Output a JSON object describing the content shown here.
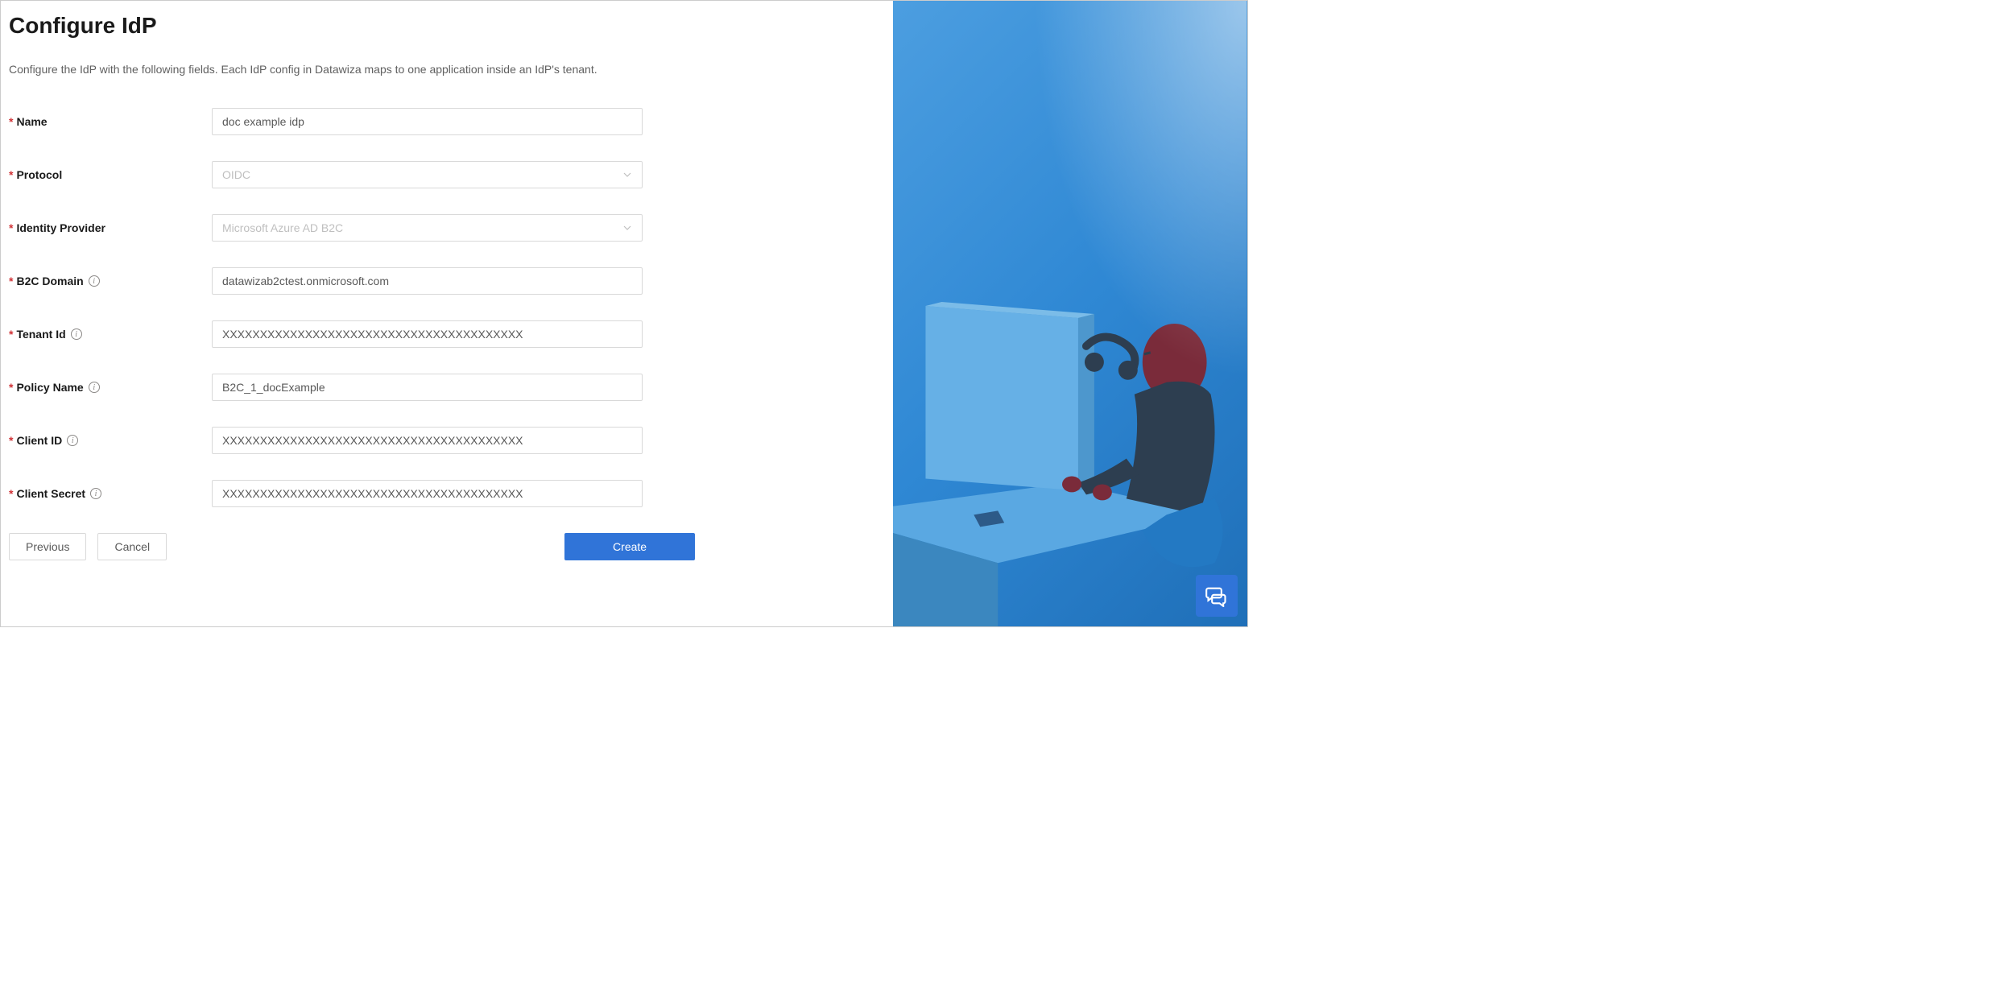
{
  "header": {
    "title": "Configure IdP",
    "description": "Configure the IdP with the following fields. Each IdP config in Datawiza maps to one application inside an IdP's tenant."
  },
  "form": {
    "fields": [
      {
        "label": "Name",
        "required": true,
        "info": false,
        "type": "text",
        "value": "doc example idp"
      },
      {
        "label": "Protocol",
        "required": true,
        "info": false,
        "type": "select",
        "value": "OIDC"
      },
      {
        "label": "Identity Provider",
        "required": true,
        "info": false,
        "type": "select",
        "value": "Microsoft Azure AD B2C"
      },
      {
        "label": "B2C Domain",
        "required": true,
        "info": true,
        "type": "text",
        "value": "datawizab2ctest.onmicrosoft.com"
      },
      {
        "label": "Tenant Id",
        "required": true,
        "info": true,
        "type": "text",
        "value": "XXXXXXXXXXXXXXXXXXXXXXXXXXXXXXXXXXXXXXXX"
      },
      {
        "label": "Policy Name",
        "required": true,
        "info": true,
        "type": "text",
        "value": "B2C_1_docExample"
      },
      {
        "label": "Client ID",
        "required": true,
        "info": true,
        "type": "text",
        "value": "XXXXXXXXXXXXXXXXXXXXXXXXXXXXXXXXXXXXXXXX"
      },
      {
        "label": "Client Secret",
        "required": true,
        "info": true,
        "type": "text",
        "value": "XXXXXXXXXXXXXXXXXXXXXXXXXXXXXXXXXXXXXXXX"
      }
    ],
    "buttons": {
      "previous": "Previous",
      "cancel": "Cancel",
      "create": "Create"
    }
  }
}
